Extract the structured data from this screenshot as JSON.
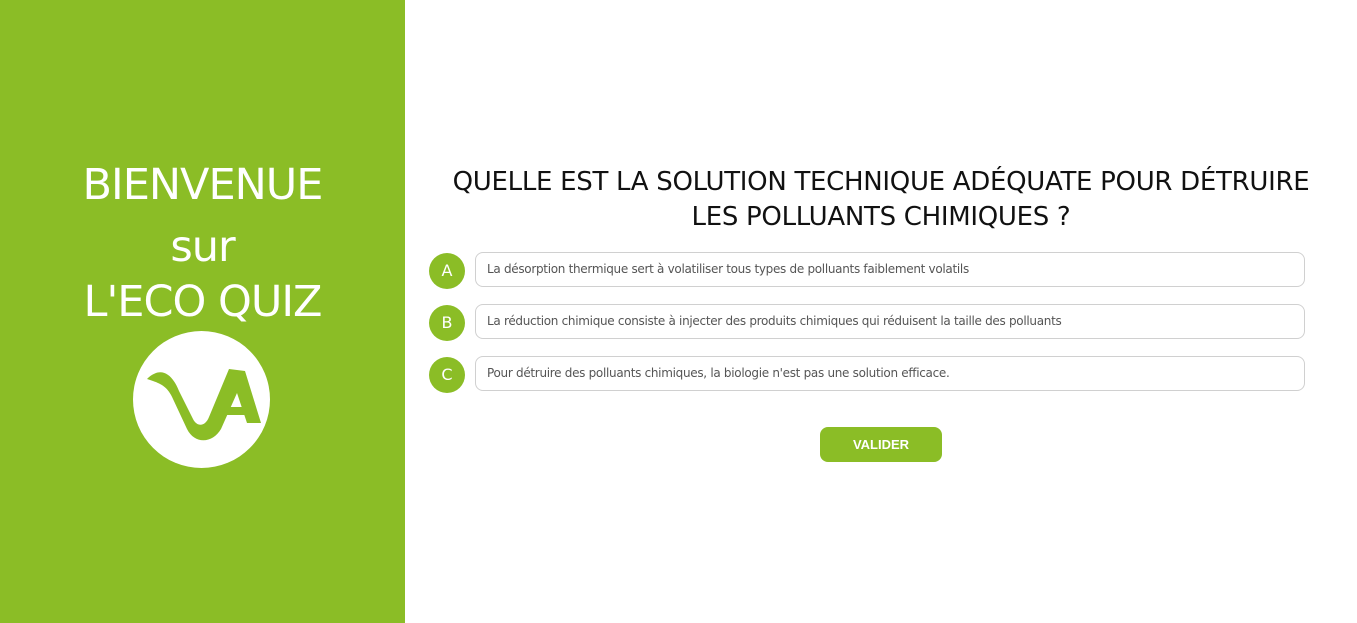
{
  "colors": {
    "brand": "#8bbd26",
    "text_dark": "#111111",
    "answer_text": "#555555"
  },
  "sidebar": {
    "welcome_line1": "BIENVENUE",
    "welcome_line2": "sur",
    "welcome_line3": "L'ECO QUIZ",
    "logo_icon": "va-logo-icon"
  },
  "quiz": {
    "question_line1": "QUELLE EST LA SOLUTION TECHNIQUE ADÉQUATE POUR DÉTRUIRE",
    "question_line2": "LES POLLUANTS CHIMIQUES ?",
    "answers": [
      {
        "letter": "A",
        "text": "La désorption thermique sert à volatiliser tous types de polluants faiblement volatils"
      },
      {
        "letter": "B",
        "text": "La réduction chimique consiste à injecter des produits chimiques qui réduisent la taille des polluants"
      },
      {
        "letter": "C",
        "text": "Pour détruire des polluants chimiques, la biologie n'est pas une solution efficace."
      }
    ],
    "submit_label": "VALIDER"
  }
}
